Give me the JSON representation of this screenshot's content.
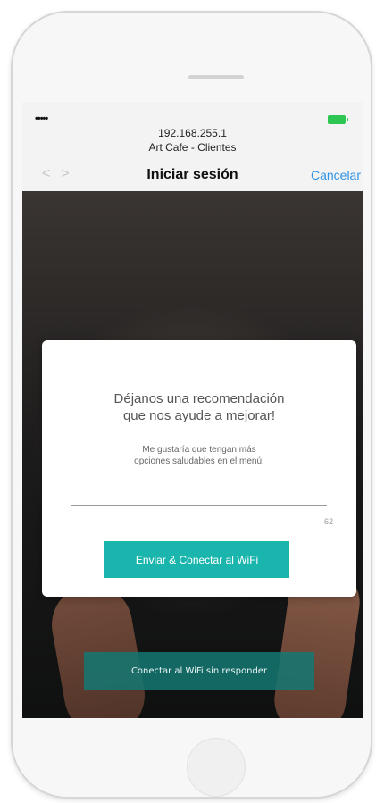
{
  "status_bar": {
    "signal": "•••••",
    "ip_address": "192.168.255.1",
    "network_name": "Art Cafe - Clientes",
    "battery_color": "#2dc653"
  },
  "nav_bar": {
    "back_arrow": "<",
    "forward_arrow": ">",
    "title": "Iniciar sesión",
    "cancel_label": "Cancelar"
  },
  "feedback_card": {
    "title_line1": "Déjanos una recomendación",
    "title_line2": "que nos ayude a mejorar!",
    "message_line1": "Me gustaría que tengan más",
    "message_line2": "opciones saludables en el menú!",
    "char_counter": "62",
    "submit_label": "Enviar & Conectar al WiFi"
  },
  "skip_button_label": "Conectar al WiFi sin responder",
  "colors": {
    "accent": "#1ab5ad",
    "link": "#2f92e6"
  }
}
